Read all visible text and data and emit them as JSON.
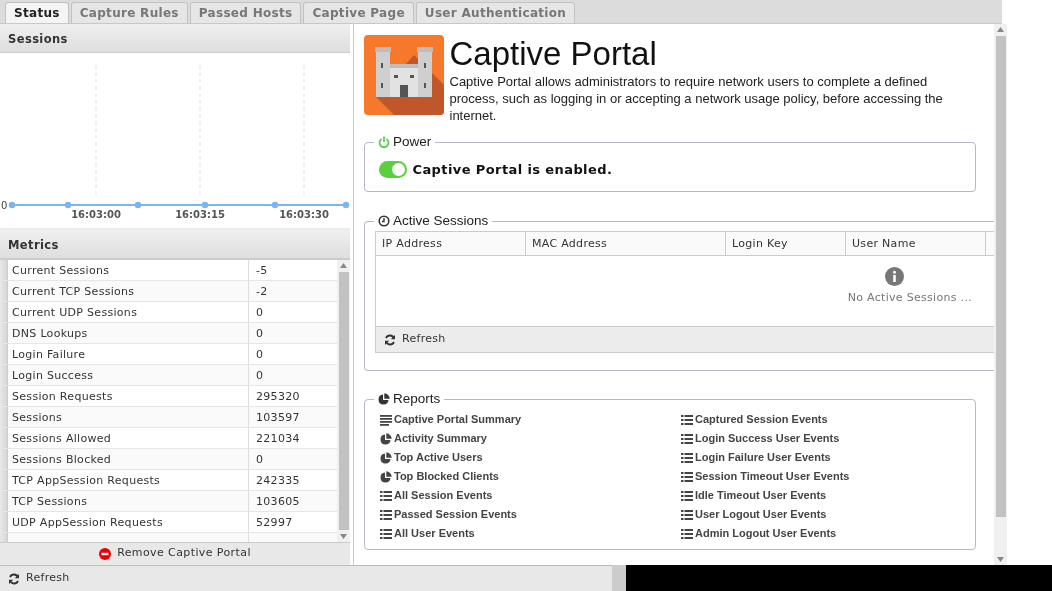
{
  "tabs": [
    {
      "label": "Status",
      "selected": true
    },
    {
      "label": "Capture Rules",
      "selected": false
    },
    {
      "label": "Passed Hosts",
      "selected": false
    },
    {
      "label": "Captive Page",
      "selected": false
    },
    {
      "label": "User Authentication",
      "selected": false
    }
  ],
  "sessions_panel": {
    "title": "Sessions",
    "y_label": "0",
    "time_labels": [
      "16:03:00",
      "16:03:15",
      "16:03:30"
    ]
  },
  "metrics_panel": {
    "title": "Metrics",
    "rows": [
      {
        "name": "Current Sessions",
        "value": "-5"
      },
      {
        "name": "Current TCP Sessions",
        "value": "-2"
      },
      {
        "name": "Current UDP Sessions",
        "value": "0"
      },
      {
        "name": "DNS Lookups",
        "value": "0"
      },
      {
        "name": "Login Failure",
        "value": "0"
      },
      {
        "name": "Login Success",
        "value": "0"
      },
      {
        "name": "Session Requests",
        "value": "295320"
      },
      {
        "name": "Sessions",
        "value": "103597"
      },
      {
        "name": "Sessions Allowed",
        "value": "221034"
      },
      {
        "name": "Sessions Blocked",
        "value": "0"
      },
      {
        "name": "TCP AppSession Requests",
        "value": "242335"
      },
      {
        "name": "TCP Sessions",
        "value": "103605"
      },
      {
        "name": "UDP AppSession Requests",
        "value": "52997"
      }
    ],
    "remove_button": "Remove Captive Portal"
  },
  "toolbar": {
    "refresh": "Refresh"
  },
  "app": {
    "title": "Captive Portal",
    "description": "Captive Portal allows administrators to require network users to complete a defined process, such as logging in or accepting a network usage policy, before accessing the internet."
  },
  "power": {
    "legend": "Power",
    "on": true,
    "status": "Captive Portal is enabled."
  },
  "active_sessions": {
    "legend": "Active Sessions",
    "columns": [
      "IP Address",
      "MAC Address",
      "Login Key",
      "User Name"
    ],
    "empty_text": "No Active Sessions ...",
    "refresh": "Refresh"
  },
  "reports": {
    "legend": "Reports",
    "columns": [
      [
        {
          "label": "Captive Portal Summary",
          "kind": "text"
        },
        {
          "label": "Activity Summary",
          "kind": "pie"
        },
        {
          "label": "Top Active Users",
          "kind": "pie"
        },
        {
          "label": "Top Blocked Clients",
          "kind": "pie"
        },
        {
          "label": "All Session Events",
          "kind": "list"
        },
        {
          "label": "Passed Session Events",
          "kind": "list"
        },
        {
          "label": "All User Events",
          "kind": "list"
        }
      ],
      [
        {
          "label": "Captured Session Events",
          "kind": "list"
        },
        {
          "label": "Login Success User Events",
          "kind": "list"
        },
        {
          "label": "Login Failure User Events",
          "kind": "list"
        },
        {
          "label": "Session Timeout User Events",
          "kind": "list"
        },
        {
          "label": "Idle Timeout User Events",
          "kind": "list"
        },
        {
          "label": "User Logout User Events",
          "kind": "list"
        },
        {
          "label": "Admin Logout User Events",
          "kind": "list"
        }
      ]
    ]
  }
}
